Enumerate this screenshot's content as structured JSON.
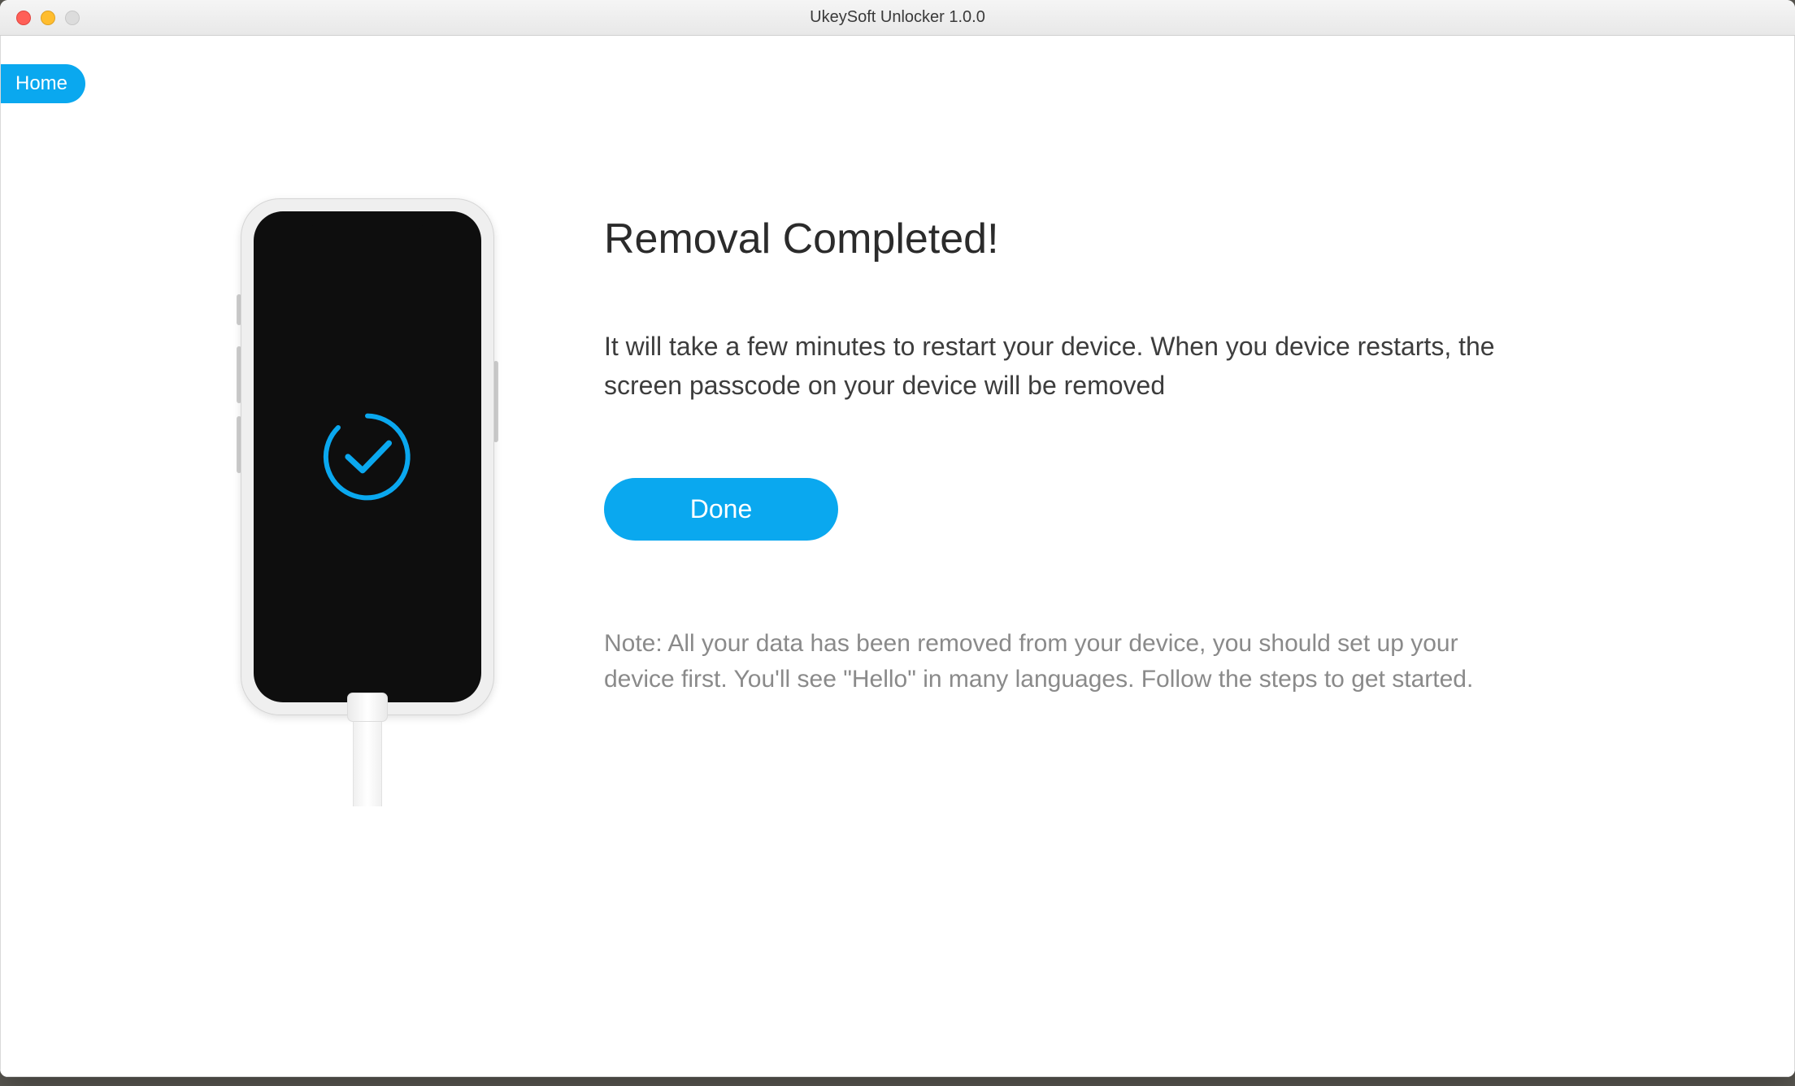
{
  "window": {
    "title": "UkeySoft Unlocker 1.0.0"
  },
  "nav": {
    "home_label": "Home"
  },
  "main": {
    "heading": "Removal Completed!",
    "description": "It will take a few minutes to restart your device. When you device restarts, the screen passcode on your device will be removed",
    "done_label": "Done",
    "note": "Note: All your data has been removed from your device, you should set up your device first. You'll see \"Hello\" in many languages. Follow the steps to get started."
  },
  "colors": {
    "accent": "#0aa8ef"
  }
}
